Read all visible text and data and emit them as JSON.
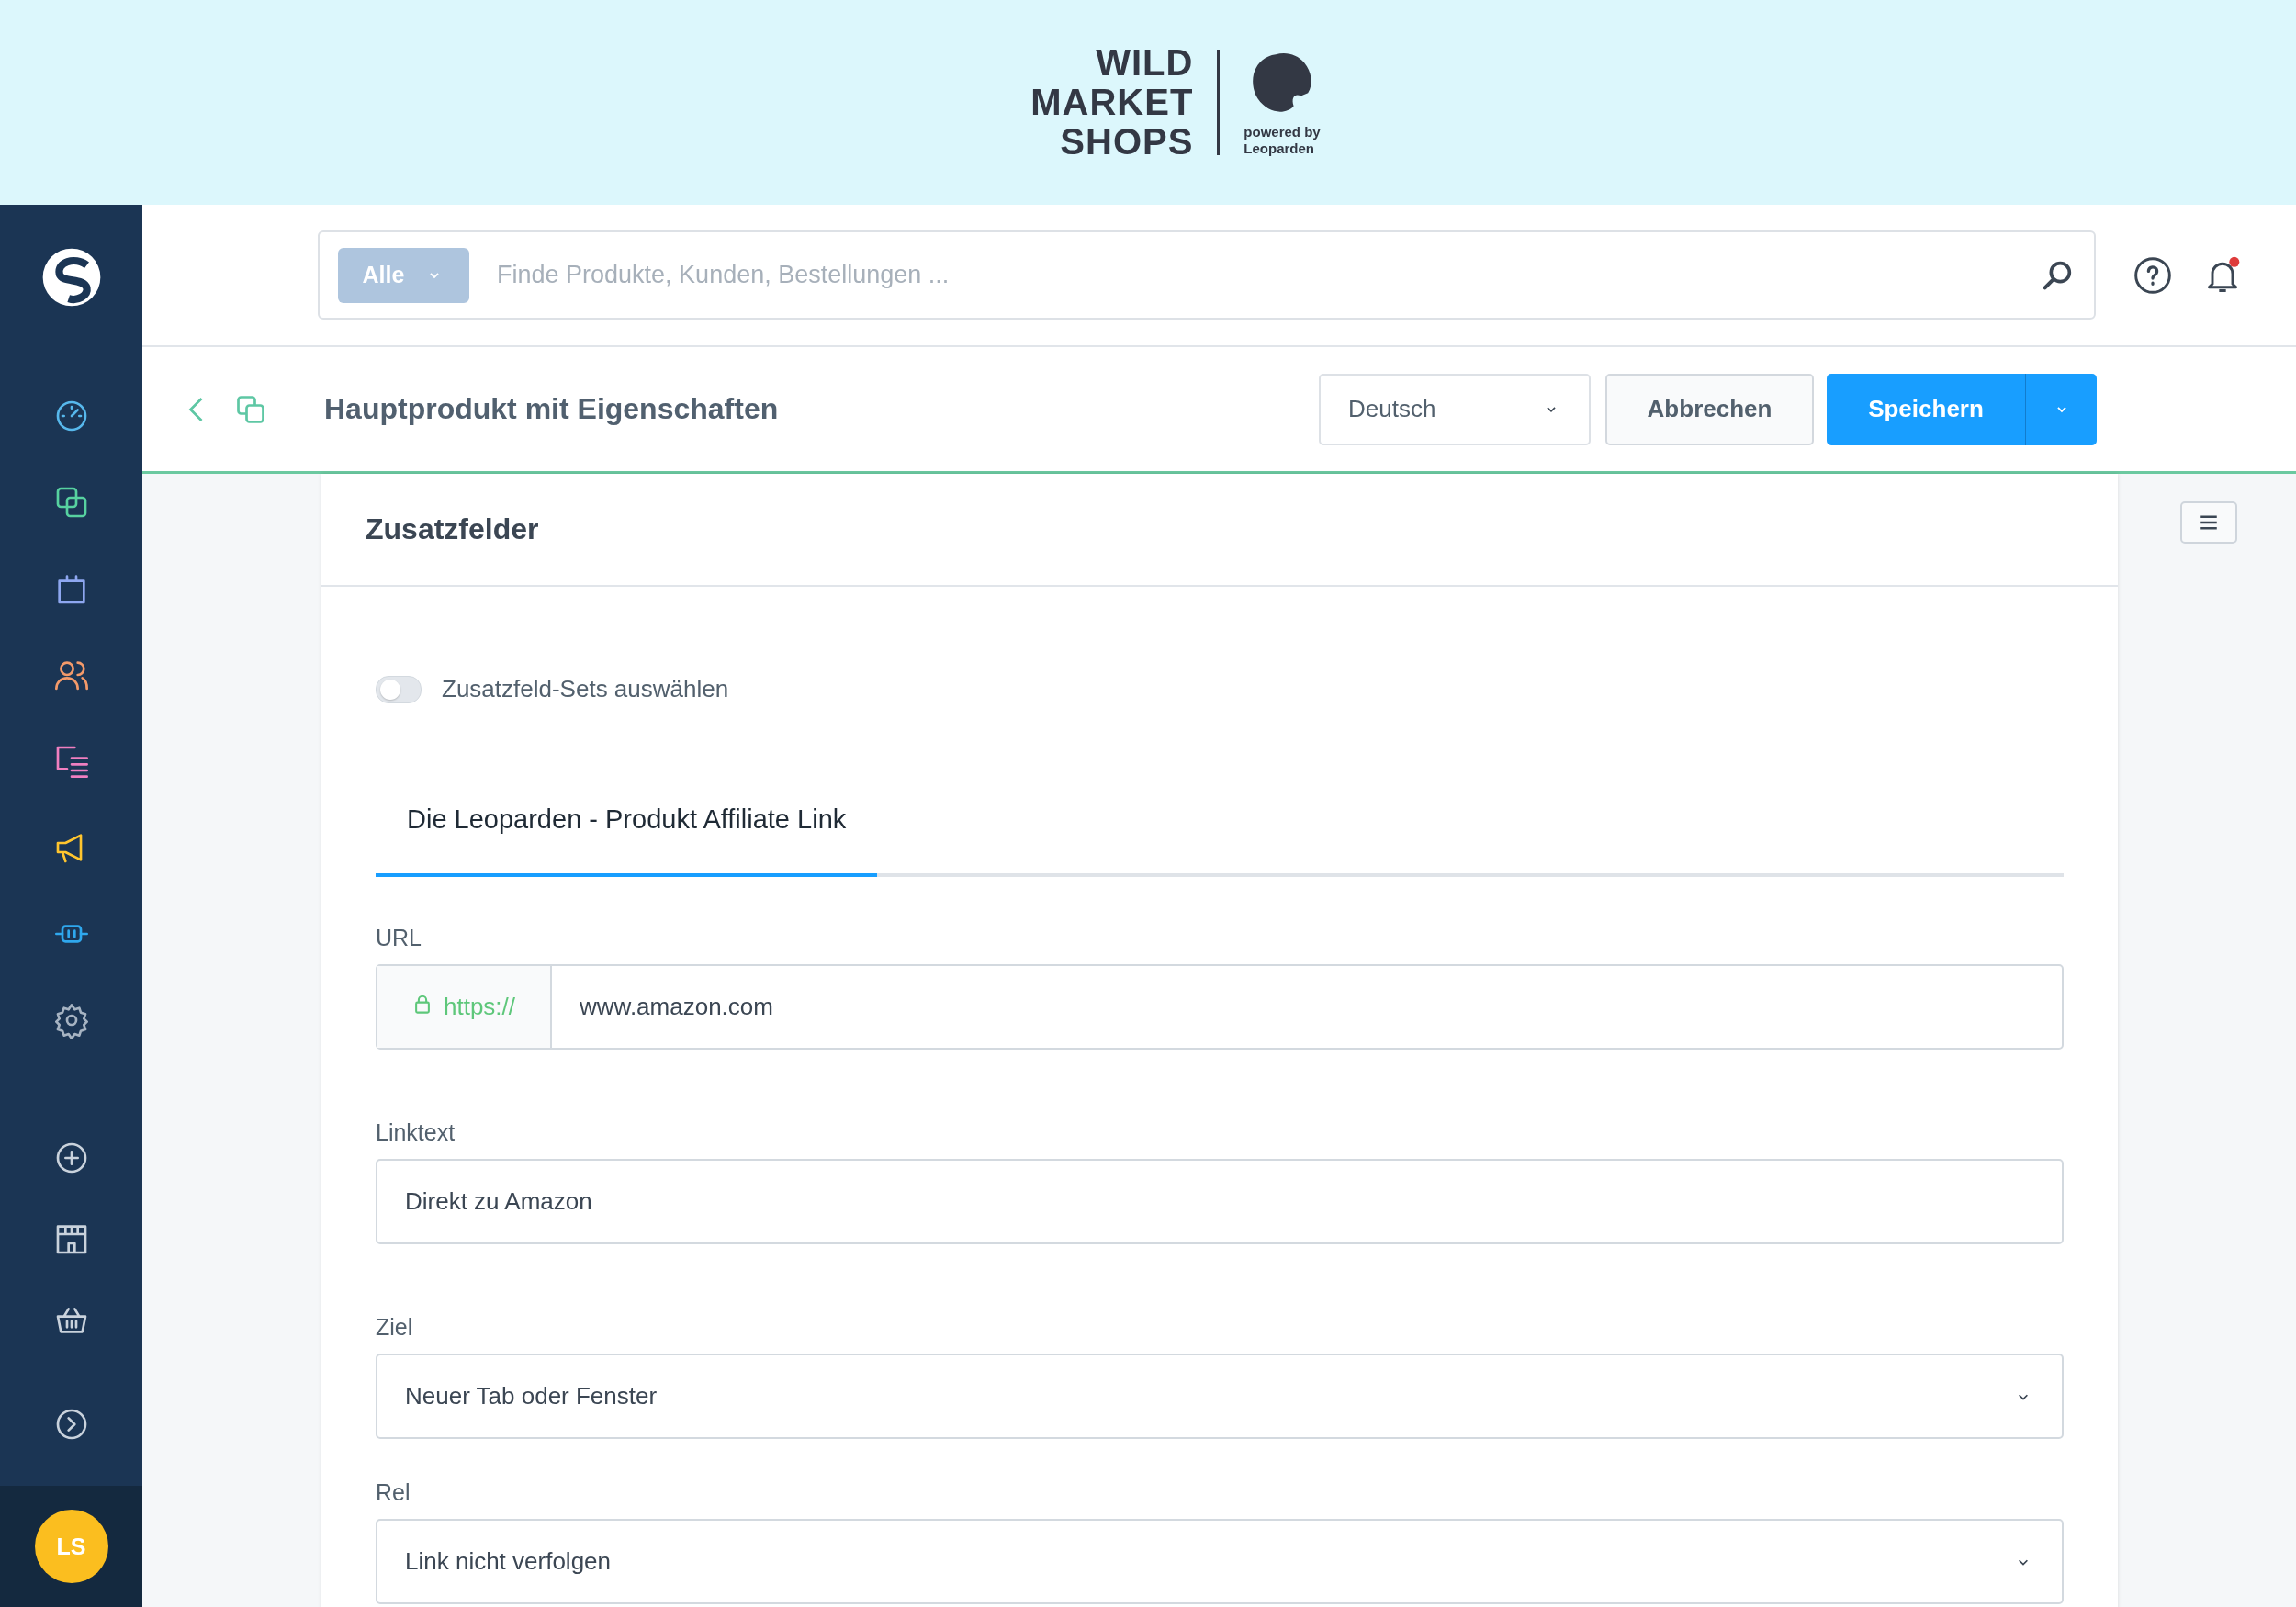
{
  "banner": {
    "logo_lines": [
      "WILD",
      "MARKET",
      "SHOPS"
    ],
    "tagline_lines": [
      "powered by",
      "Leoparden"
    ]
  },
  "sidebar": {
    "nav": [
      {
        "kind": "gauge",
        "color": "#57b8ec"
      },
      {
        "kind": "copies",
        "color": "#57d2a0"
      },
      {
        "kind": "bag",
        "color": "#8ea7f0"
      },
      {
        "kind": "people",
        "color": "#f49a6a"
      },
      {
        "kind": "list",
        "color": "#f07fc0"
      },
      {
        "kind": "megaphone",
        "color": "#ffc52e"
      },
      {
        "kind": "plug",
        "color": "#2fa8ee"
      },
      {
        "kind": "gear",
        "color": "#a6b3c2"
      }
    ],
    "extra": [
      {
        "kind": "plus"
      },
      {
        "kind": "store"
      },
      {
        "kind": "basket"
      },
      {
        "kind": "chevron"
      }
    ],
    "avatar": {
      "initials": "LS"
    }
  },
  "search": {
    "scope": "Alle",
    "placeholder": "Finde Produkte, Kunden, Bestellungen ..."
  },
  "notifications": {
    "unread": true
  },
  "toolbar": {
    "title": "Hauptprodukt mit Eigenschaften",
    "language": "Deutsch",
    "cancel": "Abbrechen",
    "save": "Speichern"
  },
  "card": {
    "title": "Zusatzfelder",
    "toggle": {
      "label": "Zusatzfeld-Sets auswählen",
      "on": false
    },
    "tabs": [
      {
        "label": "Die Leoparden - Produkt Affiliate Link",
        "selected": true
      }
    ],
    "fields": [
      {
        "kind": "url",
        "label": "URL",
        "prefix": "https://",
        "value": "www.amazon.com"
      },
      {
        "kind": "text",
        "label": "Linktext",
        "value": "Direkt zu Amazon"
      },
      {
        "kind": "select",
        "label": "Ziel",
        "value": "Neuer Tab oder Fenster"
      },
      {
        "kind": "select",
        "label": "Rel",
        "value": "Link nicht verfolgen"
      }
    ]
  }
}
